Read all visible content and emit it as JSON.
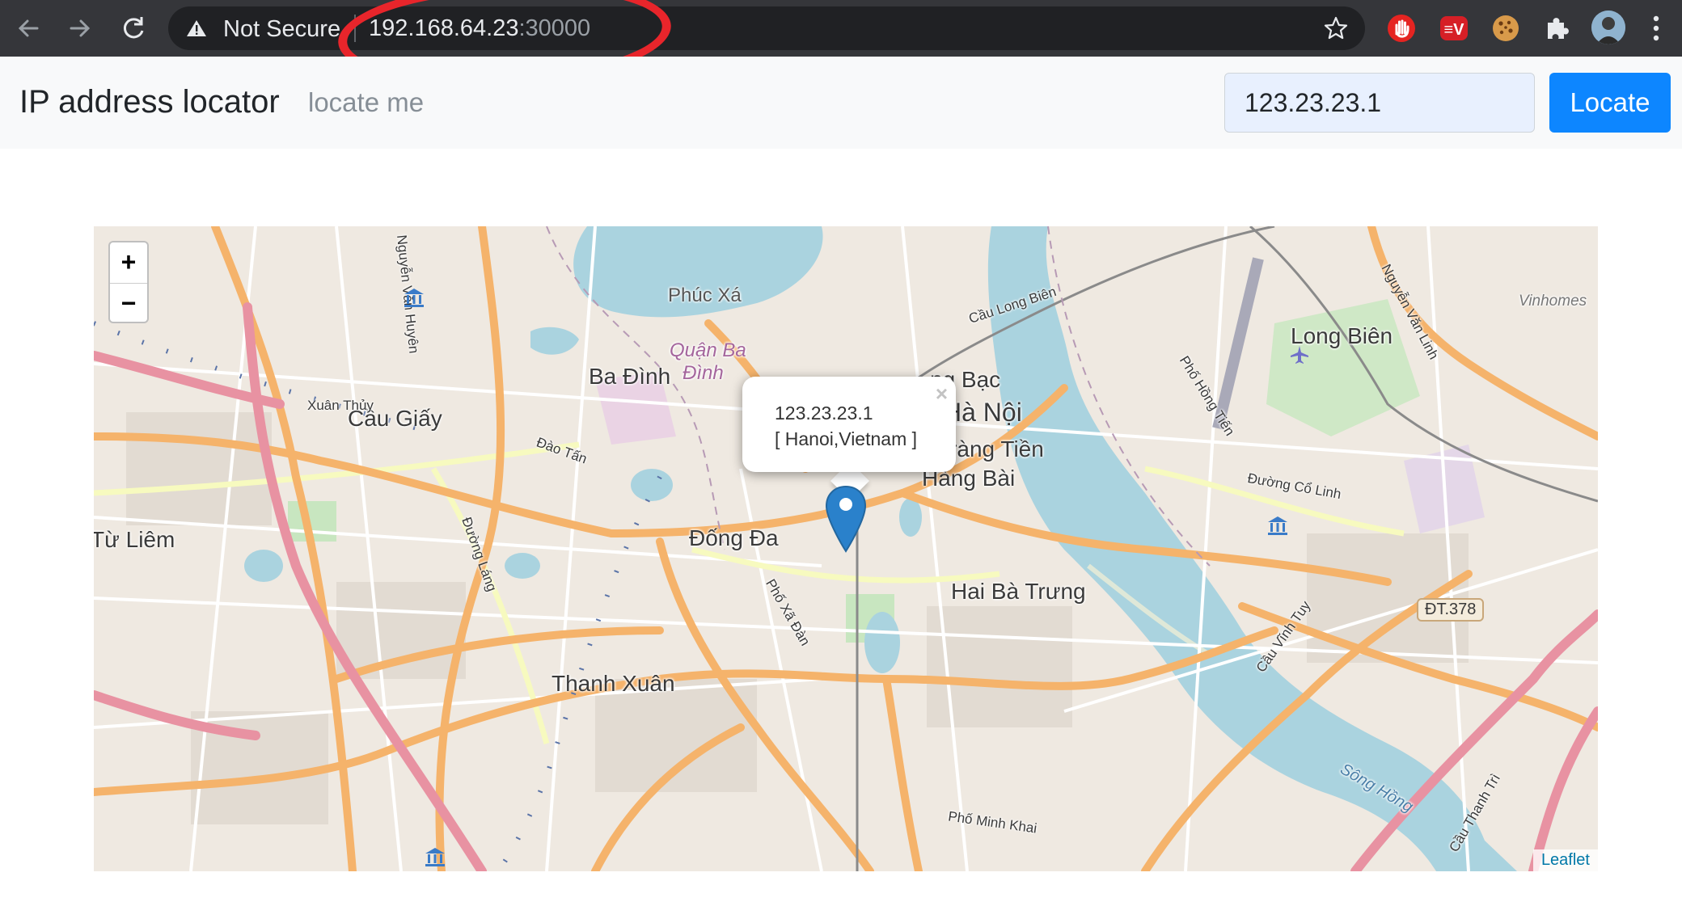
{
  "browser": {
    "security_label": "Not Secure",
    "url_host": "192.168.64.23",
    "url_port": ":30000",
    "icons": [
      "back-arrow-icon",
      "forward-arrow-icon",
      "reload-icon",
      "warning-icon",
      "bookmark-star-icon",
      "hand-stop-extension-icon",
      "ev-extension-icon",
      "cookie-extension-icon",
      "puzzle-extensions-icon",
      "profile-avatar",
      "more-menu-icon"
    ]
  },
  "navbar": {
    "brand": "IP address locator",
    "locate_me": "locate me",
    "ip_value": "123.23.23.1",
    "locate_button": "Locate"
  },
  "map": {
    "popup": {
      "ip": "123.23.23.1",
      "location": "[ Hanoi,Vietnam ]",
      "close": "×"
    },
    "zoom_in": "+",
    "zoom_out": "−",
    "attribution": "Leaflet",
    "labels": {
      "phuc_xa": "Phúc Xá",
      "ba_dinh": "Ba Đình",
      "quan_ba_dinh": "Quận Ba",
      "dinh": "Đình",
      "hang_bac": "ng Bạc",
      "ha_noi": "Hà Nội",
      "trang_tien": "Tràng Tiền",
      "hang_bai": "Hàng Bài",
      "cau_giay": "Cầu Giấy",
      "dong_da": "Đống Đa",
      "hai_ba_trung": "Hai Bà Trưng",
      "thanh_xuan": "Thanh Xuân",
      "tu_liem": "Từ Liêm",
      "long_bien": "Long Biên",
      "vinhomes": "Vinhomes",
      "dt378": "ĐT.378",
      "xuan_thuy": "Xuân Thủy",
      "dao_tan": "Đào Tấn",
      "duong_co_linh": "Đường Cổ Linh",
      "pho_minh_khai": "Phố Minh Khai",
      "song_hong": "Sông Hồng",
      "cau_long_bien": "Cầu Long Biên",
      "cau_vinh_tuy": "Cầu Vĩnh Tuy",
      "pho_xa_dan": "Phố Xã Đàn",
      "duong_lang": "Đường Láng",
      "nguyen_van_huyen": "Nguyễn Văn Huyên",
      "nguyen_van_linh": "Nguyễn Văn Linh",
      "pho_hong_tien": "Phố Hồng Tiến",
      "cau_thanh_tri": "Cầu Thanh Trì"
    }
  }
}
